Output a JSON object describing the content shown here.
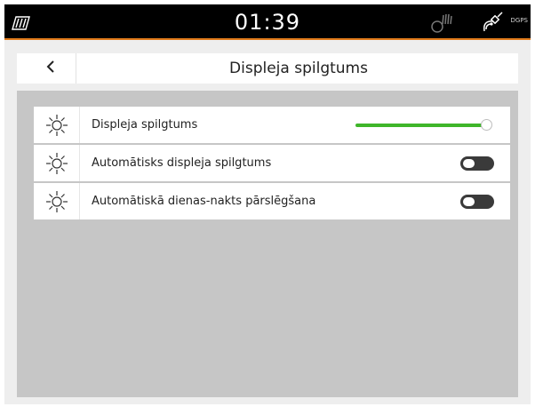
{
  "status_bar": {
    "time": "01:39",
    "left_icon": "terminal-signal-icon",
    "gps_icon": "gps-signal-icon",
    "satellite_icon": "satellite-icon",
    "dgps_label": "DGPS",
    "accent_color": "#e07a1a"
  },
  "header": {
    "back_icon": "chevron-left-icon",
    "title": "Displeja spilgtums"
  },
  "settings": {
    "rows": [
      {
        "icon": "sun-icon",
        "label": "Displeja spilgtums",
        "control": "slider",
        "value_fraction": 1.0,
        "color": "#3fb62a"
      },
      {
        "icon": "sun-icon",
        "label": "Automātisks displeja spilgtums",
        "control": "toggle",
        "enabled": false
      },
      {
        "icon": "sun-icon",
        "label": "Automātiskā dienas-nakts pārslēgšana",
        "control": "toggle",
        "enabled": false
      }
    ]
  }
}
